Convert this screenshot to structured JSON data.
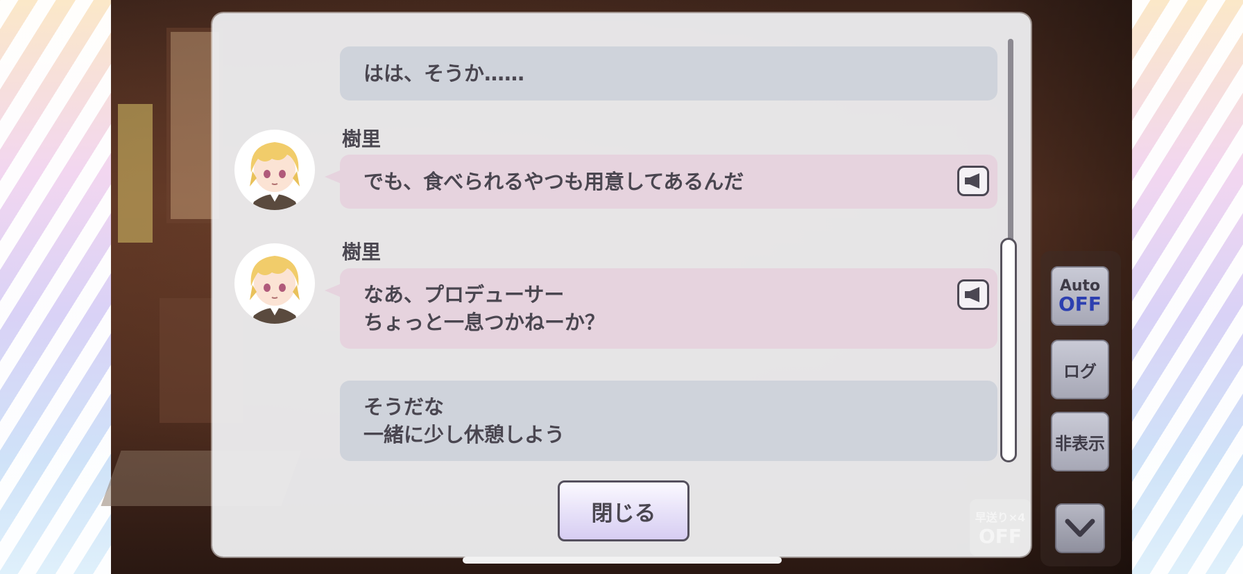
{
  "log": {
    "entries": [
      {
        "type": "narration",
        "lines": [
          "はは、そうか……"
        ]
      },
      {
        "type": "character",
        "speaker": "樹里",
        "lines": [
          "でも、食べられるやつも用意してあるんだ"
        ],
        "voice_icon": "speaker-icon"
      },
      {
        "type": "character",
        "speaker": "樹里",
        "lines": [
          "なあ、プロデューサー",
          "ちょっと一息つかねーか？"
        ],
        "voice_icon": "speaker-icon"
      },
      {
        "type": "narration",
        "lines": [
          "そうだな",
          "一緒に少し休憩しよう"
        ]
      }
    ],
    "close_label": "閉じる"
  },
  "controls": {
    "auto_label": "Auto",
    "auto_state": "OFF",
    "log_label": "ログ",
    "hide_label": "非表示",
    "fast_forward_label": "早送り×4",
    "fast_forward_state": "OFF",
    "down_icon": "chevron-down-icon"
  },
  "colors": {
    "narration_bubble": "#cfd3db",
    "character_bubble": "#e6d3de",
    "auto_off_text": "#2c3fb0",
    "panel_bg": "#ececee"
  }
}
